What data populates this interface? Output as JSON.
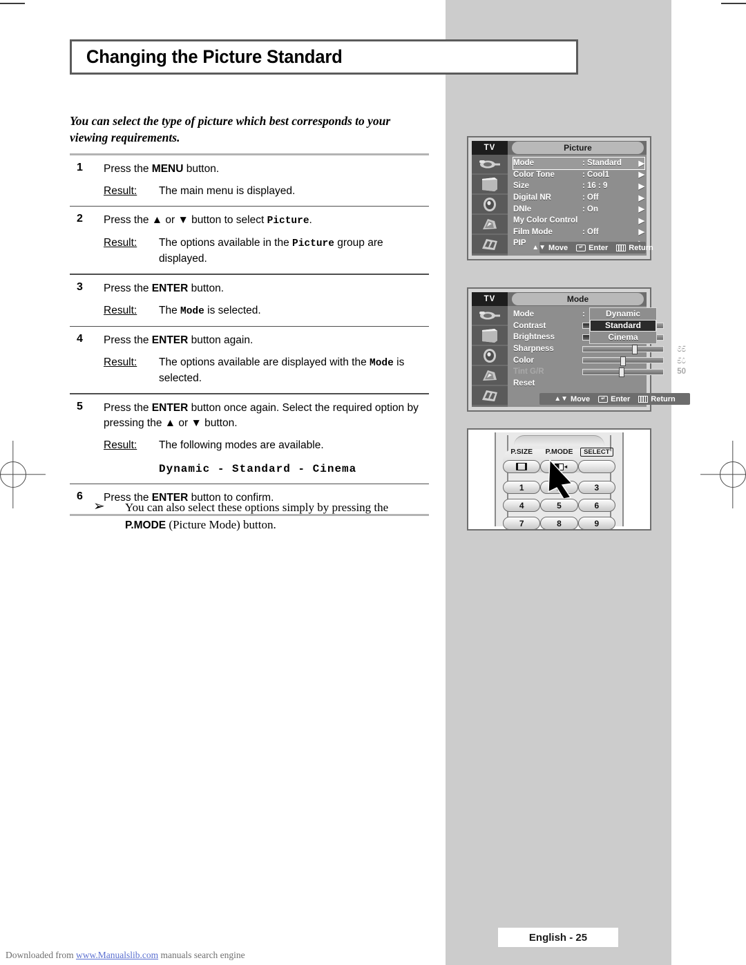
{
  "page": {
    "title": "Changing the Picture Standard",
    "intro": "You can select the type of picture which best corresponds to your viewing requirements.",
    "page_label": "English - 25",
    "footer_prefix": "Downloaded from ",
    "footer_link": "www.Manualslib.com",
    "footer_suffix": " manuals search engine"
  },
  "steps": [
    {
      "num": "1",
      "instruction_pre": "Press the ",
      "instruction_key": "MENU",
      "instruction_post": " button.",
      "result_label": "Result:",
      "result_text": "The main menu is displayed."
    },
    {
      "num": "2",
      "instruction_pre": "Press the ▲ or ▼ button to select ",
      "instruction_key": "Picture",
      "instruction_post": ".",
      "result_label": "Result:",
      "result_pre": "The options available in the ",
      "result_mono": "Picture",
      "result_post": " group are displayed."
    },
    {
      "num": "3",
      "instruction_pre": "Press the ",
      "instruction_key": "ENTER",
      "instruction_post": " button.",
      "result_label": "Result:",
      "result_pre": "The ",
      "result_mono": "Mode",
      "result_post": " is selected."
    },
    {
      "num": "4",
      "instruction_pre": "Press the ",
      "instruction_key": "ENTER",
      "instruction_post": " button again.",
      "result_label": "Result:",
      "result_pre": "The options available are displayed with the ",
      "result_mono": "Mode",
      "result_post": " is selected."
    },
    {
      "num": "5",
      "instruction_pre": "Press the ",
      "instruction_key": "ENTER",
      "instruction_post": " button once again. Select the required option by pressing the ▲ or ▼ button.",
      "result_label": "Result:",
      "result_text": "The following modes are available.",
      "modes": "Dynamic  -  Standard  -  Cinema"
    },
    {
      "num": "6",
      "instruction_pre": "Press the ",
      "instruction_key": "ENTER",
      "instruction_post": " button to confirm."
    }
  ],
  "note": {
    "bullet": "➢",
    "text_pre": "You can also select these options simply by pressing the ",
    "key": "P.MODE",
    "text_post": " (Picture Mode) button."
  },
  "osd_picture": {
    "tv_label": "TV",
    "title": "Picture",
    "rows": [
      {
        "label": "Mode",
        "value": ": Standard",
        "arrow": "▶",
        "highlight": true
      },
      {
        "label": "Color Tone",
        "value": ": Cool1",
        "arrow": "▶"
      },
      {
        "label": "Size",
        "value": ": 16 : 9",
        "arrow": "▶"
      },
      {
        "label": "Digital NR",
        "value": ": Off",
        "arrow": "▶"
      },
      {
        "label": "DNIe",
        "value": ": On",
        "arrow": "▶"
      },
      {
        "label": "My Color Control",
        "value": "",
        "arrow": "▶"
      },
      {
        "label": "Film Mode",
        "value": ": Off",
        "arrow": "▶"
      },
      {
        "label": "PIP",
        "value": "",
        "arrow": "▶"
      }
    ],
    "footer": {
      "move": "Move",
      "enter": "Enter",
      "return": "Return"
    }
  },
  "osd_mode": {
    "tv_label": "TV",
    "title": "Mode",
    "rows": [
      {
        "label": "Mode",
        "type": "value",
        "value": ":"
      },
      {
        "label": "Contrast",
        "type": "slider",
        "fill": 30,
        "knob": 32
      },
      {
        "label": "Brightness",
        "type": "slider",
        "fill": 42,
        "knob": 44
      },
      {
        "label": "Sharpness",
        "type": "slider",
        "fill": 0,
        "knob": 65,
        "num": "65"
      },
      {
        "label": "Color",
        "type": "slider",
        "fill": 0,
        "knob": 50,
        "num": "50"
      },
      {
        "label": "Tint G/R",
        "type": "slider",
        "fill": 0,
        "knob": 48,
        "num": "50",
        "dim": true
      },
      {
        "label": "Reset",
        "type": "value",
        "value": ""
      }
    ],
    "dropdown": [
      {
        "label": "Dynamic",
        "selected": false
      },
      {
        "label": "Standard",
        "selected": true
      },
      {
        "label": "Cinema",
        "selected": false
      }
    ],
    "footer": {
      "move": "Move",
      "enter": "Enter",
      "return": "Return"
    }
  },
  "remote": {
    "labels": {
      "psize": "P.SIZE",
      "pmode": "P.MODE",
      "select": "SELECT"
    },
    "keypad": [
      [
        "1",
        "2",
        "3"
      ],
      [
        "4",
        "5",
        "6"
      ],
      [
        "7",
        "8",
        "9"
      ]
    ]
  },
  "colors": {
    "gray_band": "#cccccc",
    "osd_bg": "#8e8e8e",
    "osd_title_pill": "#b9b9b9",
    "link": "#5a6fd0"
  }
}
